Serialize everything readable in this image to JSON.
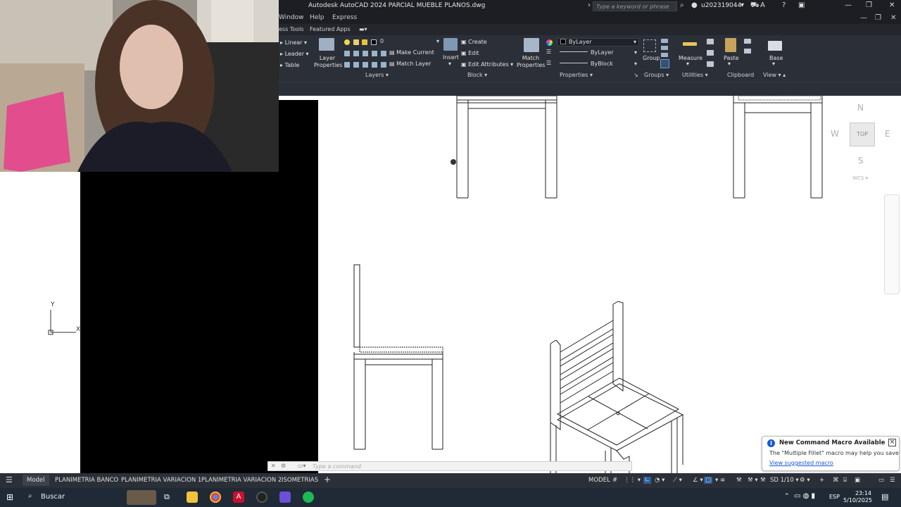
{
  "window": {
    "title": "Autodesk AutoCAD 2024   PARCIAL MUEBLE PLANOS.dwg",
    "search_placeholder": "Type a keyword or phrase",
    "user": "u202319044"
  },
  "menu": [
    "Window",
    "Help",
    "Express"
  ],
  "ribbon_tabs": [
    "ess Tools",
    "Featured Apps"
  ],
  "ribbon": {
    "annotation": {
      "linear": "Linear",
      "leader": "Leader",
      "table": "Table"
    },
    "layers": {
      "layer_properties": "Layer Properties",
      "current_layer": "0",
      "make_current": "Make Current",
      "match_layer": "Match Layer",
      "title": "Layers"
    },
    "block": {
      "insert": "Insert",
      "create": "Create",
      "edit": "Edit",
      "edit_attributes": "Edit Attributes",
      "title": "Block"
    },
    "properties": {
      "match_properties": "Match Properties",
      "color": "ByLayer",
      "linetype": "ByLayer",
      "lineweight": "ByBlock",
      "title": "Properties"
    },
    "groups": {
      "group": "Group",
      "title": "Groups"
    },
    "utilities": {
      "measure": "Measure",
      "title": "Utilities"
    },
    "clipboard": {
      "paste": "Paste",
      "title": "Clipboard"
    },
    "view": {
      "base": "Base",
      "title": "View"
    }
  },
  "viewcube": {
    "north": "N",
    "south": "S",
    "east": "E",
    "west": "W",
    "face": "TOP",
    "wcs": "WCS"
  },
  "ucs": {
    "y": "Y",
    "x": "X"
  },
  "command_line": {
    "placeholder": "Type a command"
  },
  "notification": {
    "title": "New Command Macro Available",
    "body": "The \"Multiple Fillet\" macro may help you save time",
    "link": "View suggested macro"
  },
  "layout_tabs": [
    "Model",
    "PLANIMETRIA BANCO",
    "PLANIMETRIA VARIACION 1",
    "PLANIMETRIA VARIACION 2",
    "ISOMETRIAS"
  ],
  "status_bar": {
    "model": "MODEL",
    "scale": "SD 1/10"
  },
  "taskbar": {
    "search": "Buscar",
    "language": "ESP",
    "time": "23:14",
    "date": "5/10/2025"
  }
}
